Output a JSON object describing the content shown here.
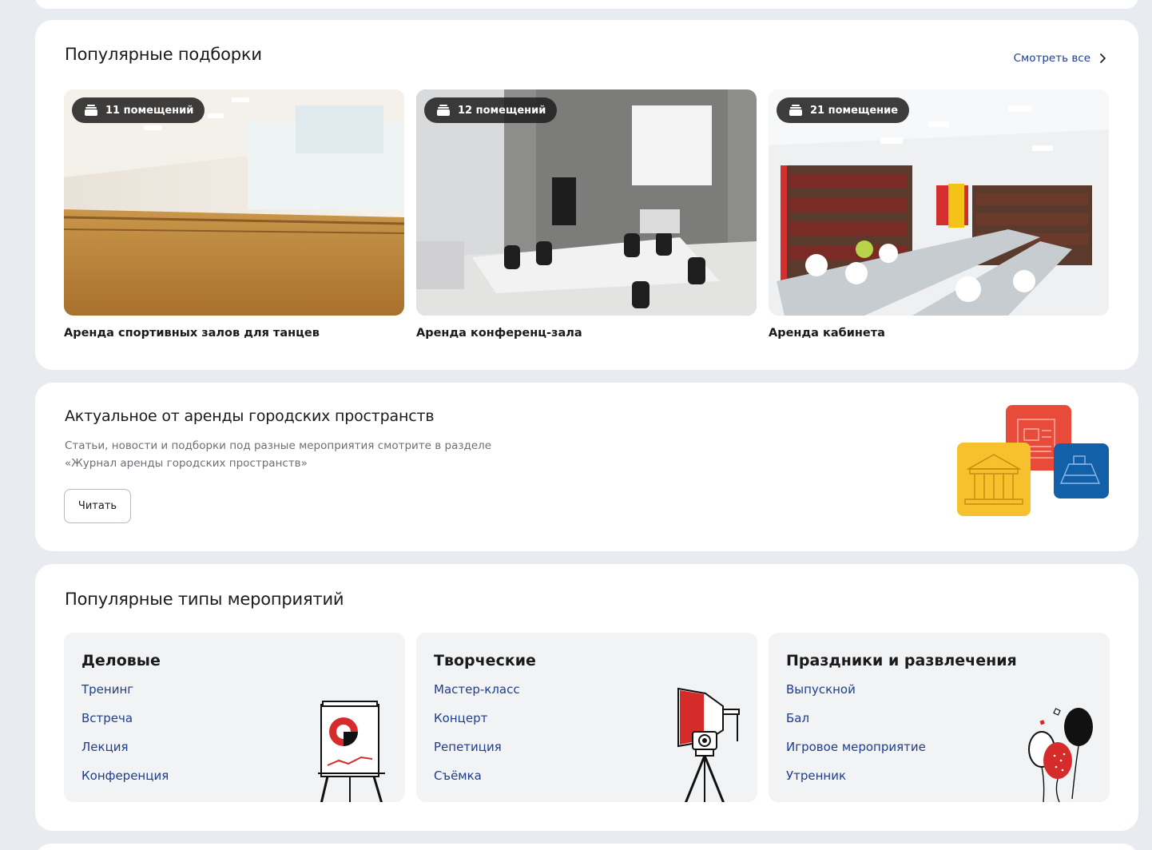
{
  "collections": {
    "title": "Популярные подборки",
    "see_all": "Смотреть все",
    "tiles": [
      {
        "badge": "11 помещений",
        "caption": "Аренда спортивных залов для танцев"
      },
      {
        "badge": "12 помещений",
        "caption": "Аренда конференц-зала"
      },
      {
        "badge": "21 помещение",
        "caption": "Аренда кабинета"
      }
    ]
  },
  "journal": {
    "title": "Актуальное от аренды городских пространств",
    "desc_line1": "Статьи, новости и подборки под разные мероприятия смотрите в разделе",
    "desc_line2": "«Журнал аренды городских пространств»",
    "read_button": "Читать"
  },
  "events": {
    "title": "Популярные типы мероприятий",
    "groups": [
      {
        "title": "Деловые",
        "items": [
          "Тренинг",
          "Встреча",
          "Лекция",
          "Конференция"
        ]
      },
      {
        "title": "Творческие",
        "items": [
          "Мастер-класс",
          "Концерт",
          "Репетиция",
          "Съёмка"
        ]
      },
      {
        "title": "Праздники и развлечения",
        "items": [
          "Выпускной",
          "Бал",
          "Игровое мероприятие",
          "Утренник"
        ]
      }
    ]
  },
  "icons": {
    "badge": "stack-icon",
    "see_all": "chevron-right-icon"
  },
  "colors": {
    "link": "#1d3d8f",
    "page_bg": "#e8ebf0",
    "card_bg": "#ffffff",
    "event_box_bg": "#f2f3f5",
    "accent_red": "#e84b3a",
    "accent_yellow": "#f6c12c",
    "accent_blue": "#1260a8"
  }
}
